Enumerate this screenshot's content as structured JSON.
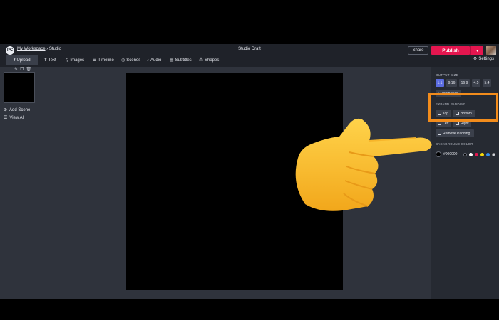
{
  "header": {
    "logo": "PC",
    "workspace": "My Workspace",
    "separator": "›",
    "section": "Studio",
    "title": "Studio Draft",
    "share": "Share",
    "publish": "Publish",
    "publish_caret": "▾"
  },
  "toolbar": {
    "upload": "Upload",
    "text": "Text",
    "images": "Images",
    "timeline": "Timeline",
    "scenes": "Scenes",
    "audio": "Audio",
    "subtitles": "Subtitles",
    "shapes": "Shapes",
    "settings": "Settings"
  },
  "left": {
    "add_scene": "Add Scene",
    "view_all": "View All"
  },
  "right": {
    "output_size_label": "OUTPUT SIZE",
    "sizes": [
      "1:1",
      "9:16",
      "16:9",
      "4:5",
      "5:4"
    ],
    "active_size": "1:1",
    "custom_size": "Custom Size",
    "expand_padding_label": "EXPAND PADDING",
    "top": "Top",
    "bottom": "Bottom",
    "left": "Left",
    "right": "Right",
    "remove_padding": "Remove Padding",
    "background_color_label": "BACKGROUND COLOR",
    "hex": "#000000",
    "palette": [
      "#000000",
      "#ffffff",
      "#e4164f",
      "#f5d90a",
      "#2f8cf0",
      "#cfd3dc"
    ]
  },
  "colors": {
    "accent": "#e4164f",
    "active": "#5b6ce0",
    "highlight": "#f28c1c",
    "panel": "#262a32",
    "workspace": "#2f333c"
  }
}
